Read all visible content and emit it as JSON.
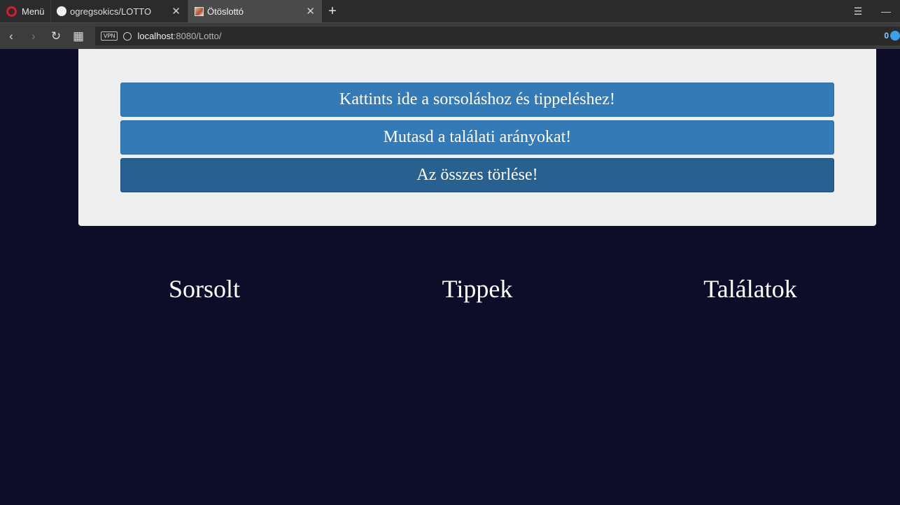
{
  "browser": {
    "menu_label": "Menü",
    "tabs": [
      {
        "title": "ogregsokics/LOTTO",
        "icon": "github-icon"
      },
      {
        "title": "Ötöslottó",
        "icon": "lotto-favicon"
      }
    ],
    "url_host": "localhost",
    "url_rest": ":8080/Lotto/",
    "vpn_label": "VPN",
    "badge_count": "0"
  },
  "page": {
    "buttons": {
      "draw_tip": "Kattints ide a sorsoláshoz és tippeléshez!",
      "show_ratios": "Mutasd a találati arányokat!",
      "delete_all": "Az összes törlése!"
    },
    "columns": {
      "drawn": "Sorsolt",
      "tips": "Tippek",
      "hits": "Találatok"
    }
  },
  "colors": {
    "page_bg": "#0d0d2a",
    "panel_bg": "#efefef",
    "button_primary": "#337ab7",
    "button_active": "#286090"
  }
}
